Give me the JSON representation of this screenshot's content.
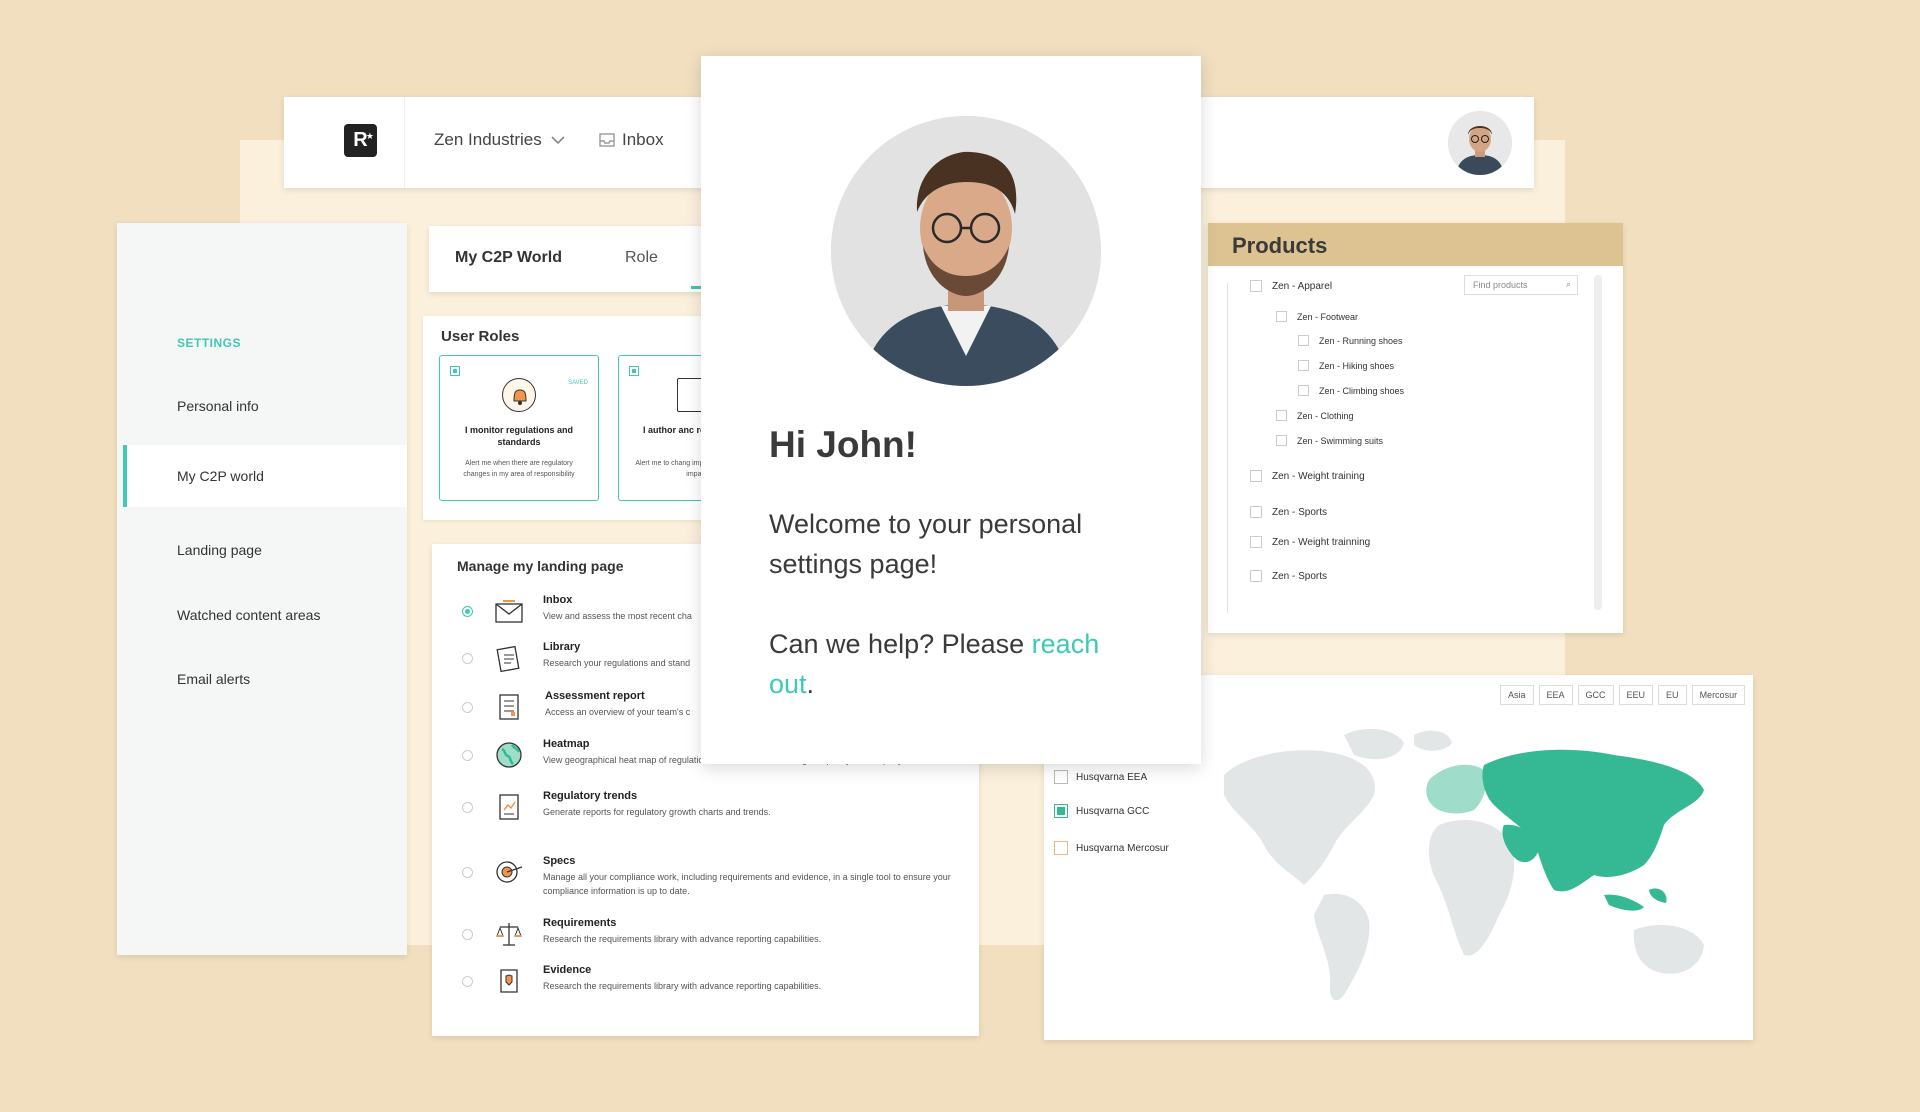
{
  "topbar": {
    "logo": "R",
    "organization": "Zen Industries",
    "inbox_label": "Inbox"
  },
  "sidebar": {
    "heading": "SETTINGS",
    "items": [
      {
        "label": "Personal info"
      },
      {
        "label": "My C2P world"
      },
      {
        "label": "Landing page"
      },
      {
        "label": "Watched content areas"
      },
      {
        "label": "Email alerts"
      }
    ]
  },
  "tabs": {
    "world": "My C2P World",
    "role": "Role"
  },
  "user_roles": {
    "title": "User Roles",
    "cards": [
      {
        "saved": "SAVED",
        "title": "I monitor regulations and standards",
        "desc": "Alert me when there are regulatory changes in my area of responsibility"
      },
      {
        "title": "I author anc requirem",
        "desc": "Alert me to chang impact the requiren that impact m"
      }
    ]
  },
  "landing": {
    "title": "Manage my landing page",
    "items": [
      {
        "name": "Inbox",
        "desc": "View and assess the most recent cha"
      },
      {
        "name": "Library",
        "desc": "Research your regulations and stand"
      },
      {
        "name": "Assessment report",
        "desc": "Access an overview of your team's c"
      },
      {
        "name": "Heatmap",
        "desc": "View geographical heat map of regulations and standards that might impact your company."
      },
      {
        "name": "Regulatory trends",
        "desc": "Generate reports for regulatory growth charts and trends."
      },
      {
        "name": "Specs",
        "desc": "Manage all your compliance work, including requirements and evidence, in a single tool to ensure your compliance information is up to date."
      },
      {
        "name": "Requirements",
        "desc": "Research the requirements library with advance reporting capabilities."
      },
      {
        "name": "Evidence",
        "desc": "Research the requirements library with advance reporting capabilities."
      }
    ]
  },
  "welcome": {
    "greeting": "Hi John!",
    "message": "Welcome to your personal settings page!",
    "help_prefix": "Can we help? Please ",
    "help_link": "reach out",
    "help_suffix": "."
  },
  "products": {
    "title": "Products",
    "search_placeholder": "Find products",
    "items": [
      {
        "label": "Zen - Apparel"
      },
      {
        "label": "Zen - Footwear"
      },
      {
        "label": "Zen - Running shoes"
      },
      {
        "label": "Zen - Hiking shoes"
      },
      {
        "label": "Zen - Climbing shoes"
      },
      {
        "label": "Zen - Clothing"
      },
      {
        "label": "Zen - Swimming suits"
      },
      {
        "label": "Zen - Weight training"
      },
      {
        "label": "Zen - Sports"
      },
      {
        "label": "Zen - Weight trainning"
      },
      {
        "label": "Zen - Sports"
      }
    ]
  },
  "map": {
    "region_tabs": [
      "Asia",
      "EEA",
      "GCC",
      "EEU",
      "EU",
      "Mercosur"
    ],
    "legend": [
      {
        "label": "Husqvarna EEA",
        "checked": false
      },
      {
        "label": "Husqvarna GCC",
        "checked": true
      },
      {
        "label": "Husqvarna Mercosur",
        "checked": false
      }
    ],
    "colors": {
      "highlight": "#35b894",
      "light": "#9fdcc9",
      "land": "#e3e6e7"
    }
  },
  "colors": {
    "accent": "#3ec9b5",
    "background": "#f1dfbf",
    "products_header": "#dcc391"
  }
}
